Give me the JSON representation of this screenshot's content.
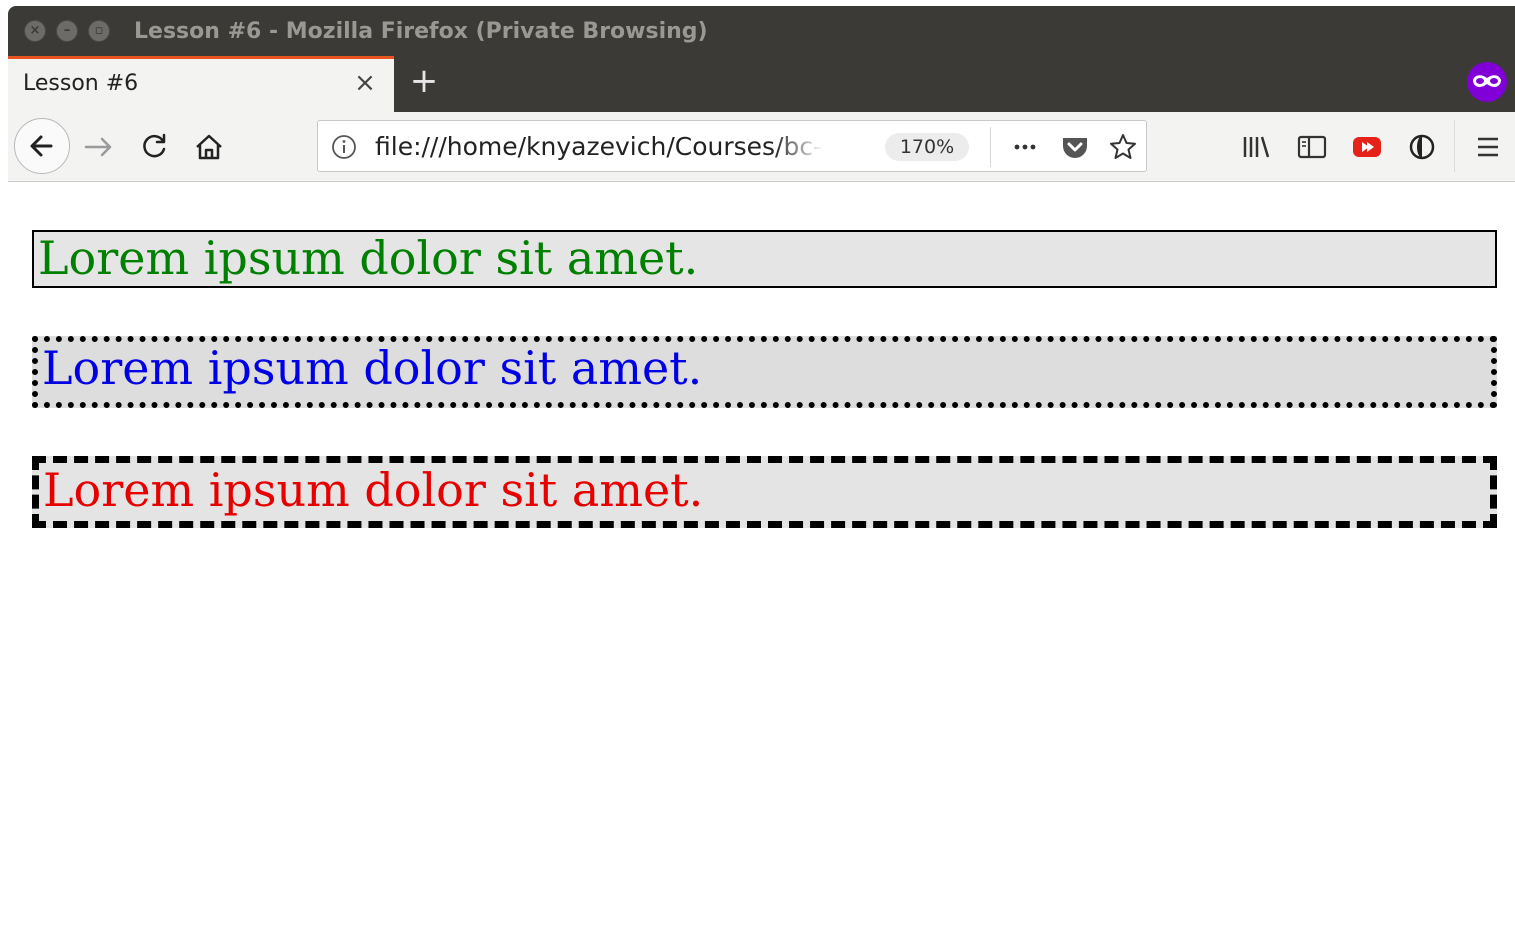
{
  "window": {
    "title": "Lesson #6 - Mozilla Firefox (Private Browsing)",
    "controls": [
      "close",
      "minimize",
      "maximize"
    ]
  },
  "tabs": [
    {
      "label": "Lesson #6",
      "active": true
    }
  ],
  "colors": {
    "title_bar": "#3b3a37",
    "tab_accent": "#e95420",
    "private_badge": "#8000d7",
    "green_text": "#008000",
    "blue_text": "#0000e6",
    "red_text": "#e60000"
  },
  "toolbar": {
    "url": "file:///home/knyazevich/Courses/bc-d",
    "zoom": "170%",
    "icons": [
      "back-icon",
      "forward-icon",
      "reload-icon",
      "home-icon",
      "info-icon",
      "more-icon",
      "pocket-icon",
      "star-icon",
      "library-icon",
      "sidebar-icon",
      "youtube-icon",
      "addon-icon",
      "menu-icon"
    ]
  },
  "page": {
    "paragraphs": [
      {
        "text": "Lorem ipsum dolor sit amet.",
        "border": "solid"
      },
      {
        "text": "Lorem ipsum dolor sit amet.",
        "border": "dotted"
      },
      {
        "text": "Lorem ipsum dolor sit amet.",
        "border": "dashed"
      }
    ]
  }
}
